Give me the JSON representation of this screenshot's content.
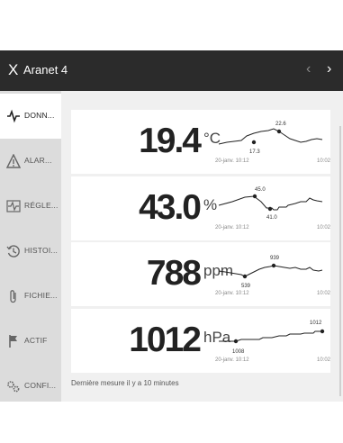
{
  "window": {
    "title": "Aranet 4",
    "close_glyph": "X",
    "prev_glyph": "‹",
    "next_glyph": "›"
  },
  "sidebar": {
    "items": [
      {
        "label": "DONN...",
        "icon": "pulse-icon",
        "active": true
      },
      {
        "label": "ALAR...",
        "icon": "warning-icon",
        "active": false
      },
      {
        "label": "RÉGLE...",
        "icon": "settings-pulse-icon",
        "active": false
      },
      {
        "label": "HISTOI...",
        "icon": "history-icon",
        "active": false
      },
      {
        "label": "FICHIE...",
        "icon": "paperclip-icon",
        "active": false
      },
      {
        "label": "ACTIF",
        "icon": "flag-icon",
        "active": false
      },
      {
        "label": "CONFI...",
        "icon": "gears-icon",
        "active": false
      }
    ]
  },
  "readings": [
    {
      "name": "temperature",
      "value": "19.4",
      "unit": "°C",
      "min_label": "17.3",
      "max_label": "22.6",
      "time_start": "20-janv. 10:12",
      "time_end": "10:02"
    },
    {
      "name": "humidity",
      "value": "43.0",
      "unit": "%",
      "min_label": "41.0",
      "max_label": "45.0",
      "time_start": "20-janv. 10:12",
      "time_end": "10:02"
    },
    {
      "name": "co2",
      "value": "788",
      "unit": "ppm",
      "min_label": "539",
      "max_label": "939",
      "time_start": "20-janv. 10:12",
      "time_end": "10:02"
    },
    {
      "name": "pressure",
      "value": "1012",
      "unit": "hPa",
      "min_label": "1008",
      "max_label": "1012",
      "time_start": "20-janv. 10:12",
      "time_end": "10:02"
    }
  ],
  "footer": {
    "last_measure": "Dernière mesure il y a 10 minutes"
  },
  "colors": {
    "titlebar": "#2b2b2b",
    "sidebar": "#dcdcdc",
    "content_bg": "#f0f0f0",
    "line": "#222222"
  }
}
